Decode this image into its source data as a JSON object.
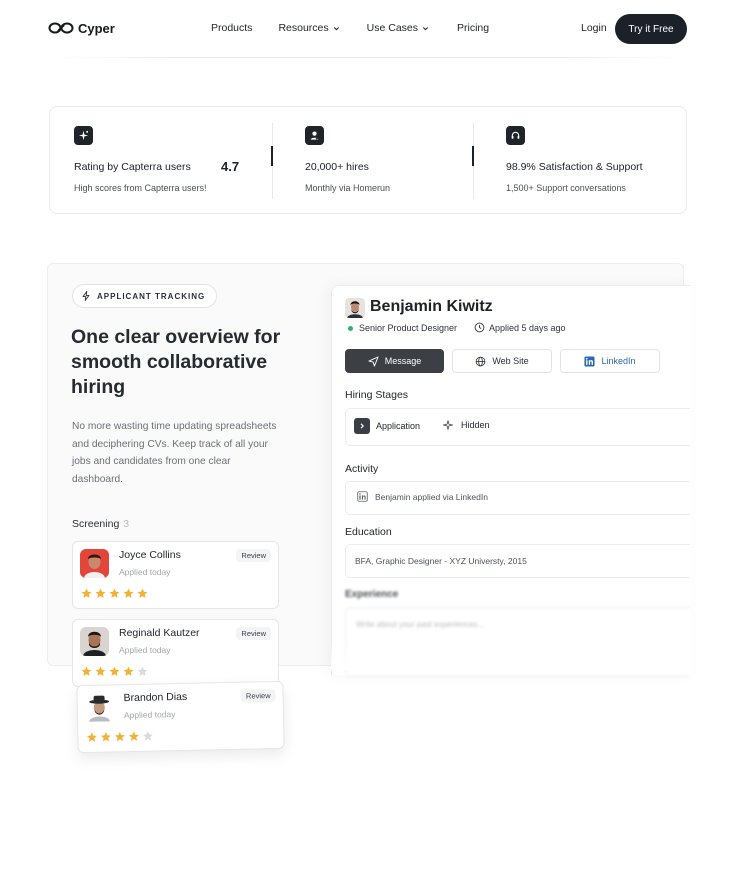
{
  "nav": {
    "logo_text": "Cyper",
    "links": [
      "Products",
      "Resources",
      "Use Cases",
      "Pricing"
    ],
    "login": "Login",
    "cta": "Try it Free"
  },
  "stats": [
    {
      "title": "Rating by Capterra users",
      "value": "4.7",
      "sub": "High scores from Capterra users!",
      "icon": "sparkle-icon"
    },
    {
      "title": "20,000+ hires",
      "sub": "Monthly via Homerun",
      "icon": "user-check-icon"
    },
    {
      "title": "98.9% Satisfaction & Support",
      "sub": "1,500+ Support conversations",
      "icon": "headset-icon"
    }
  ],
  "feature": {
    "badge": "APPLICANT TRACKING",
    "headline": "One clear overview for smooth collaborative hiring",
    "description": "No more wasting time updating spreadsheets and deciphering CVs. Keep track of all your jobs and candidates from one clear dashboard.",
    "screening_label": "Screening",
    "screening_count": "3"
  },
  "candidates": [
    {
      "name": "Joyce Collins",
      "applied": "Applied today",
      "badge": "Review",
      "rating": 5
    },
    {
      "name": "Reginald Kautzer",
      "applied": "Applied today",
      "badge": "Review",
      "rating": 4
    },
    {
      "name": "Brandon Dias",
      "applied": "Applied today",
      "badge": "Review",
      "rating": 4
    }
  ],
  "profile": {
    "name": "Benjamin Kiwitz",
    "role": "Senior Product Designer",
    "applied": "Applied 5 days ago",
    "buttons": {
      "message": "Message",
      "website": "Web Site",
      "linkedin": "LinkedIn"
    },
    "hiring_stages_title": "Hiring Stages",
    "stages": [
      "Application",
      "Hidden"
    ],
    "activity_title": "Activity",
    "activity_item": "Benjamin applied via LinkedIn",
    "education_title": "Education",
    "education_item": "BFA, Graphic Designer - XYZ Universty, 2015",
    "experience_title": "Experience",
    "experience_placeholder": "Write about your past experiences..."
  },
  "colors": {
    "primary_dark": "#1c2129",
    "star": "#f3b233",
    "star_empty": "#d9dbde",
    "status_green": "#2fb16b",
    "linkedin": "#2a69b0"
  }
}
